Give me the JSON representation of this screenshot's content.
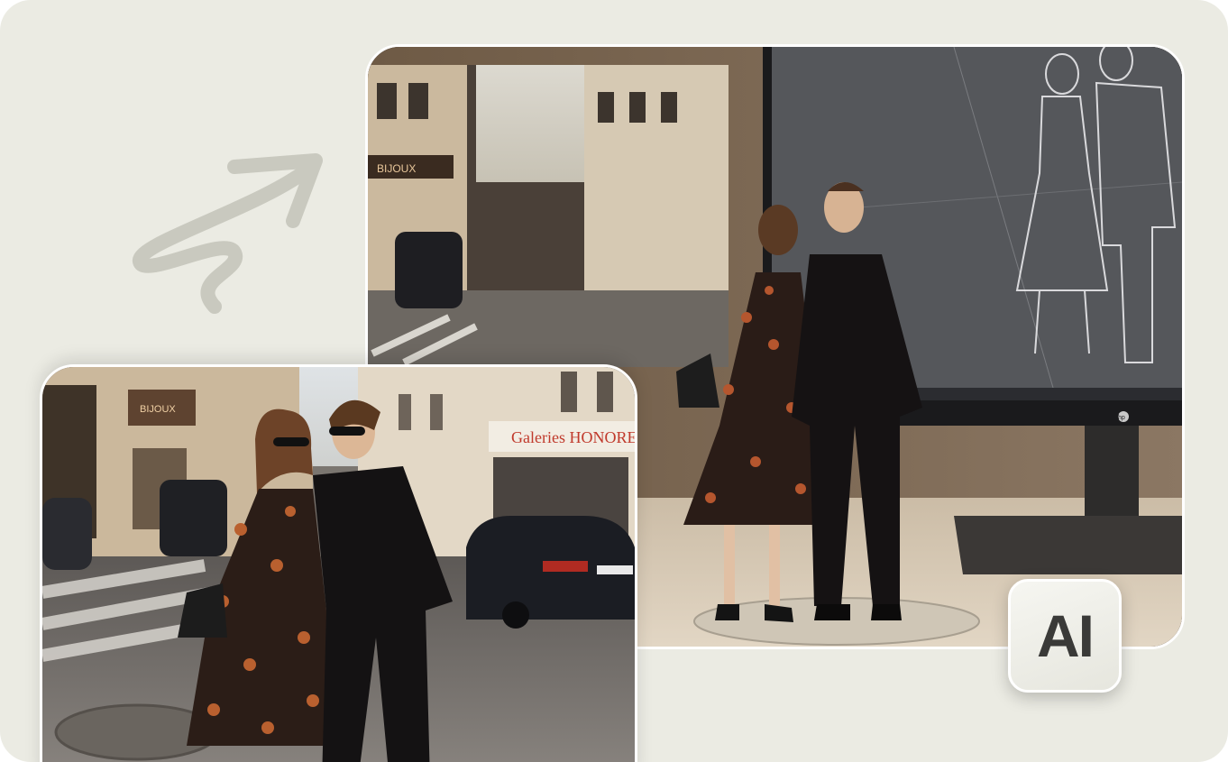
{
  "badge": {
    "label": "AI"
  },
  "back_photo": {
    "storefront_sign": "BIJOUX",
    "monitor_logo": "hp"
  },
  "front_photo": {
    "storefront_sign": "Galeries HONORE",
    "side_sign": "BIJOUX"
  },
  "colors": {
    "background": "#ebebe3",
    "card_border": "#ffffff",
    "badge_text": "#3a3a38",
    "monitor_screen": "#55575b"
  }
}
